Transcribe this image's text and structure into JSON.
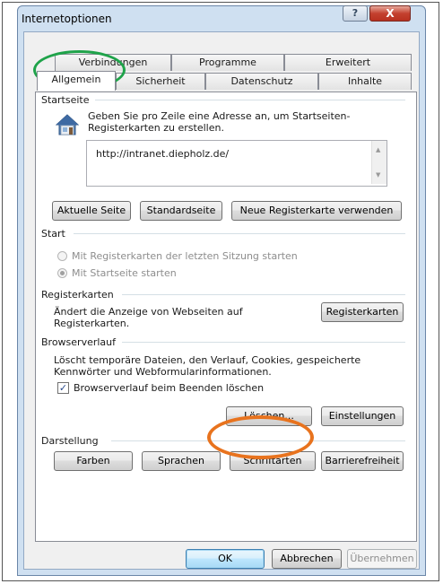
{
  "window": {
    "title": "Internetoptionen",
    "help_label": "?",
    "close_label": "X"
  },
  "tabs_back": [
    {
      "label": "Verbindungen"
    },
    {
      "label": "Programme"
    },
    {
      "label": "Erweitert"
    }
  ],
  "tabs_front": [
    {
      "label": "Allgemein",
      "active": true
    },
    {
      "label": "Sicherheit"
    },
    {
      "label": "Datenschutz"
    },
    {
      "label": "Inhalte"
    }
  ],
  "startseite": {
    "heading": "Startseite",
    "description": "Geben Sie pro Zeile eine Adresse an, um Startseiten-Registerkarten zu erstellen.",
    "url": "http://intranet.diepholz.de/",
    "buttons": {
      "current": "Aktuelle Seite",
      "default": "Standardseite",
      "new_tab": "Neue Registerkarte verwenden"
    }
  },
  "start": {
    "heading": "Start",
    "option_last_session": "Mit Registerkarten der letzten Sitzung starten",
    "option_homepage": "Mit Startseite starten"
  },
  "registerkarten": {
    "heading": "Registerkarten",
    "description": "Ändert die Anzeige von Webseiten auf Registerkarten.",
    "button": "Registerkarten"
  },
  "browserverlauf": {
    "heading": "Browserverlauf",
    "description": "Löscht temporäre Dateien, den Verlauf, Cookies, gespeicherte Kennwörter und Webformularinformationen.",
    "checkbox_label": "Browserverlauf beim Beenden löschen",
    "checkbox_checked": true,
    "delete_button": "Löschen...",
    "settings_button": "Einstellungen"
  },
  "darstellung": {
    "heading": "Darstellung",
    "buttons": {
      "colors": "Farben",
      "languages": "Sprachen",
      "fonts": "Schriftarten",
      "accessibility": "Barrierefreiheit"
    }
  },
  "footer": {
    "ok": "OK",
    "cancel": "Abbrechen",
    "apply": "Übernehmen"
  },
  "colors": {
    "highlight_green": "#1fa34a",
    "highlight_orange": "#e8731e",
    "close_red": "#c4412f"
  }
}
